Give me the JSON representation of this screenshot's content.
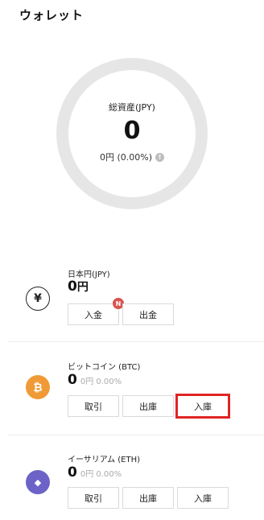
{
  "header": {
    "title": "ウォレット"
  },
  "summary": {
    "label": "総資産(JPY)",
    "total": "0",
    "change": "0円 (0.00%)",
    "ring_color": "#e6e6e6"
  },
  "assets": [
    {
      "name": "日本円(JPY)",
      "amount": "0",
      "unit": "円",
      "sub": "",
      "icon": "yen-icon",
      "icon_glyph": "¥",
      "buttons": [
        {
          "label": "入金",
          "badge": "N"
        },
        {
          "label": "出金"
        }
      ]
    },
    {
      "name": "ビットコイン (BTC)",
      "amount": "0",
      "sub": "0円 0.00%",
      "icon": "bitcoin-icon",
      "icon_glyph": "₿",
      "icon_color": "#f09a37",
      "buttons": [
        {
          "label": "取引"
        },
        {
          "label": "出庫"
        },
        {
          "label": "入庫",
          "highlighted": true
        }
      ]
    },
    {
      "name": "イーサリアム (ETH)",
      "amount": "0",
      "sub": "0円 0.00%",
      "icon": "ethereum-icon",
      "icon_glyph": "◆",
      "icon_color": "#6b63c7",
      "buttons": [
        {
          "label": "取引"
        },
        {
          "label": "出庫"
        },
        {
          "label": "入庫"
        }
      ]
    }
  ],
  "colors": {
    "highlight": "#e02424",
    "badge": "#d9534f"
  }
}
